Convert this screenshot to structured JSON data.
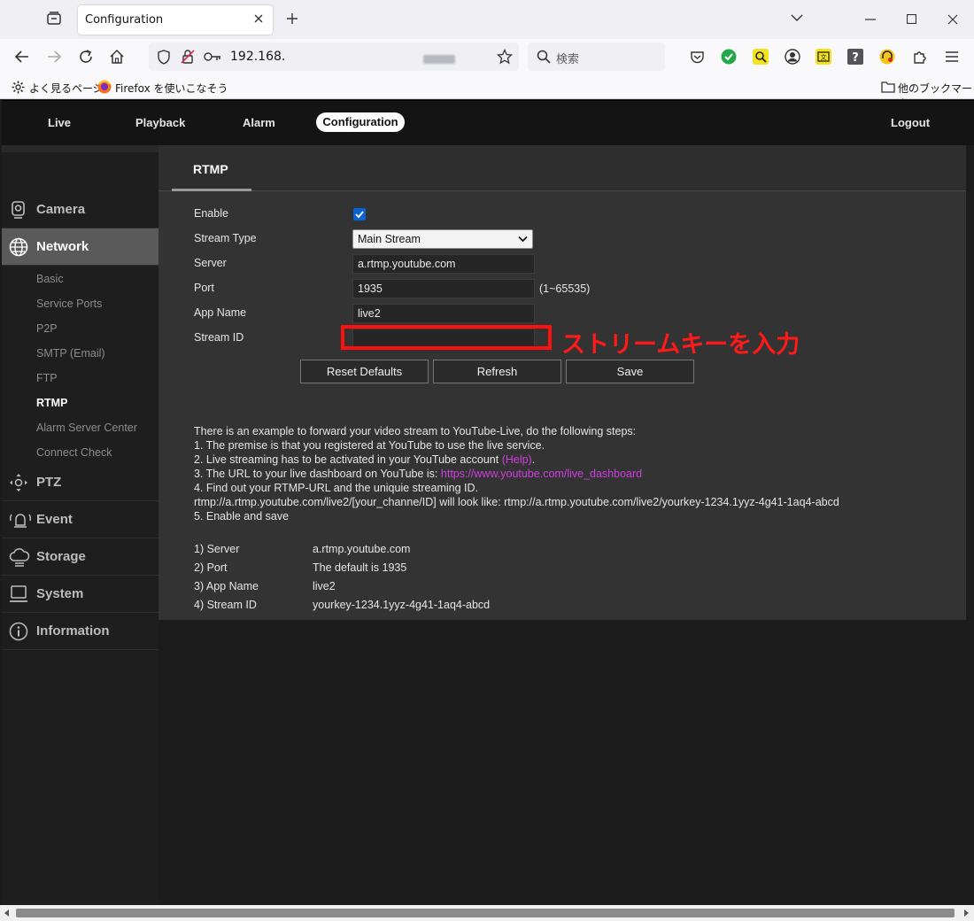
{
  "browser": {
    "tab_title": "Configuration",
    "url": "192.168.",
    "search_placeholder": "検索",
    "bookmarks": [
      {
        "label": "よく見るページ"
      },
      {
        "label": "Firefox を使いこなそう"
      }
    ],
    "other_bookmarks": "他のブックマーク"
  },
  "topnav": {
    "items": [
      "Live",
      "Playback",
      "Alarm",
      "Configuration"
    ],
    "active": "Configuration",
    "logout": "Logout"
  },
  "sidebar": {
    "main": [
      "Camera",
      "Network",
      "PTZ",
      "Event",
      "Storage",
      "System",
      "Information"
    ],
    "active_main": "Network",
    "network_sub": [
      "Basic",
      "Service Ports",
      "P2P",
      "SMTP (Email)",
      "FTP",
      "RTMP",
      "Alarm Server Center",
      "Connect Check"
    ],
    "active_sub": "RTMP"
  },
  "rtmp": {
    "title": "RTMP",
    "labels": {
      "enable": "Enable",
      "stream_type": "Stream Type",
      "server": "Server",
      "port": "Port",
      "app_name": "App Name",
      "stream_id": "Stream ID"
    },
    "values": {
      "enable": true,
      "stream_type": "Main Stream",
      "server": "a.rtmp.youtube.com",
      "port": "1935",
      "app_name": "live2",
      "stream_id": ""
    },
    "port_range": "(1~65535)",
    "buttons": {
      "reset": "Reset Defaults",
      "refresh": "Refresh",
      "save": "Save"
    },
    "annotation": "ストリームキーを入力"
  },
  "help": {
    "intro": "There is an example to forward your video stream to YouTube-Live, do the following steps:",
    "step1": "1. The premise is that you registered at YouTube to use the live service.",
    "step2": "2. Live streaming has to be activated in your YouTube account ",
    "step2_link": "(Help)",
    "step2_end": ".",
    "step3": "3. The URL to your live dashboard on YouTube is: ",
    "step3_link": "https://www.youtube.com/live_dashboard",
    "step4": "4. Find out your RTMP-URL and the uniquie streaming ID.",
    "step4b": "rtmp://a.rtmp.youtube.com/live2/[your_channe/ID] will look like: rtmp://a.rtmp.youtube.com/live2/yourkey-1234.1yyz-4g41-1aq4-abcd",
    "step5": "5. Enable and save",
    "summary": [
      {
        "label": "1) Server",
        "value": "a.rtmp.youtube.com"
      },
      {
        "label": "2) Port",
        "value": "The default is 1935"
      },
      {
        "label": "3) App Name",
        "value": "live2"
      },
      {
        "label": "4) Stream ID",
        "value": "yourkey-1234.1yyz-4g41-1aq4-abcd"
      }
    ]
  },
  "colors": {
    "accent_blue": "#0a63d6",
    "annotation_red": "#ff1a1a",
    "link_magenta": "#d13ee0"
  }
}
